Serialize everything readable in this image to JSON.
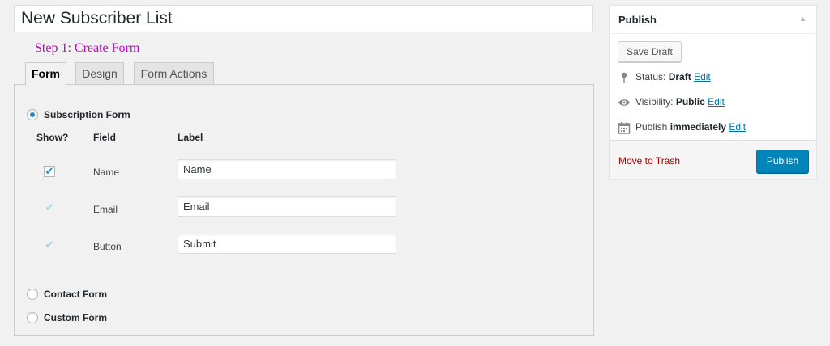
{
  "post_title": "New Subscriber List",
  "step_heading": "Step 1: Create Form",
  "tabs": [
    {
      "label": "Form",
      "active": true
    },
    {
      "label": "Design",
      "active": false
    },
    {
      "label": "Form Actions",
      "active": false
    }
  ],
  "form_types": [
    {
      "label": "Subscription Form",
      "selected": true
    },
    {
      "label": "Contact Form",
      "selected": false
    },
    {
      "label": "Custom Form",
      "selected": false
    }
  ],
  "columns": {
    "show": "Show?",
    "field": "Field",
    "label": "Label"
  },
  "fields": [
    {
      "field": "Name",
      "label_value": "Name",
      "checked": true,
      "editable": true
    },
    {
      "field": "Email",
      "label_value": "Email",
      "checked": true,
      "editable": false
    },
    {
      "field": "Button",
      "label_value": "Submit",
      "checked": true,
      "editable": false
    }
  ],
  "publish_box": {
    "title": "Publish",
    "save_draft": "Save Draft",
    "status_label": "Status:",
    "status_value": "Draft",
    "visibility_label": "Visibility:",
    "visibility_value": "Public",
    "publish_label": "Publish",
    "publish_value": "immediately",
    "edit_label": "Edit",
    "trash_label": "Move to Trash",
    "publish_button": "Publish"
  },
  "colors": {
    "accent": "#0085ba",
    "step_heading": "#c400c4",
    "trash": "#aa0000"
  }
}
